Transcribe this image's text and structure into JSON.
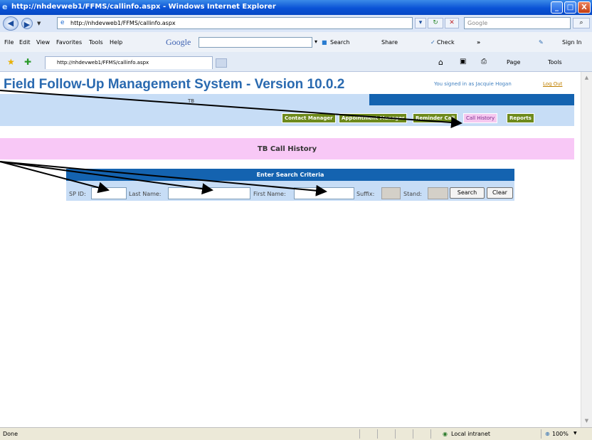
{
  "window": {
    "title": "http://nhdevweb1/FFMS/callinfo.aspx - Windows Internet Explorer",
    "minimize": "_",
    "maximize": "□",
    "close": "X"
  },
  "address": {
    "url": "http://nhdevweb1/FFMS/callinfo.aspx",
    "search_placeholder": "Google"
  },
  "menu": {
    "items": [
      "File",
      "Edit",
      "View",
      "Favorites",
      "Tools",
      "Help"
    ],
    "google_label": "Google",
    "search_label": "Search",
    "share_label": "Share",
    "check_label": "Check",
    "signin_label": "Sign In"
  },
  "tab": {
    "title": "http://nhdevweb1/FFMS/callinfo.aspx",
    "page_label": "Page",
    "tools_label": "Tools"
  },
  "app": {
    "title": "Field Follow-Up Management System - Version 10.0.2",
    "signed_in": "You signed in as Jacquie Hogan",
    "logout": "Log Out",
    "program": "TB",
    "nav": [
      "Contact Manager",
      "Appointment Manager",
      "Reminder Call",
      "Call History",
      "Reports"
    ],
    "page_heading": "TB Call History"
  },
  "search": {
    "header": "Enter Search Criteria",
    "sp_id_label": "SP ID:",
    "last_name_label": "Last Name:",
    "first_name_label": "First Name:",
    "suffix_label": "Suffix:",
    "stand_label": "Stand:",
    "search_button": "Search",
    "clear_button": "Clear"
  },
  "status": {
    "text": "Done",
    "zone": "Local intranet",
    "zoom": "100%"
  }
}
